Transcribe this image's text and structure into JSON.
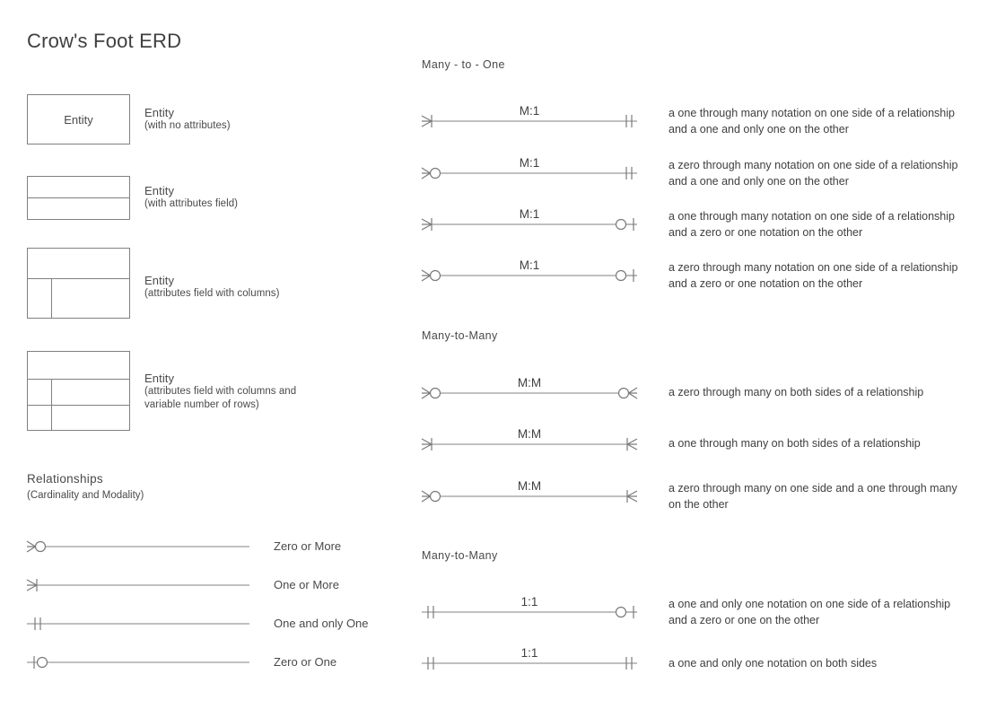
{
  "page": {
    "title": "Crow's Foot ERD",
    "background": "#ffffff",
    "line_color": "#808080",
    "text_color": "#4a4a4a"
  },
  "entities": {
    "section_items": [
      {
        "shape": "single-box",
        "inner_text": "Entity",
        "caption_title": "Entity",
        "caption_sub": "(with no attributes)"
      },
      {
        "shape": "header-plus-one-row",
        "inner_text": "",
        "caption_title": "Entity",
        "caption_sub": "(with attributes field)"
      },
      {
        "shape": "header-plus-columns",
        "inner_text": "",
        "caption_title": "Entity",
        "caption_sub": "(attributes field with columns)"
      },
      {
        "shape": "header-plus-columns-multirow",
        "inner_text": "",
        "caption_title": "Entity",
        "caption_sub": "(attributes field with columns and variable number of rows)"
      }
    ]
  },
  "relationships_section": {
    "heading": "Relationships",
    "subheading": "(Cardinality and Modality)",
    "legend": [
      {
        "symbol": "zero-or-more",
        "label": "Zero or More"
      },
      {
        "symbol": "one-or-more",
        "label": "One or More"
      },
      {
        "symbol": "one-and-only-one",
        "label": "One and only One"
      },
      {
        "symbol": "zero-or-one",
        "label": "Zero or One"
      }
    ]
  },
  "groups": [
    {
      "heading": "Many - to - One",
      "rows": [
        {
          "ratio": "M:1",
          "left_symbol": "one-or-more",
          "right_symbol": "one-and-only-one",
          "description": "a one through many notation on one side of a relationship and a one and only one on the other"
        },
        {
          "ratio": "M:1",
          "left_symbol": "zero-or-more",
          "right_symbol": "one-and-only-one",
          "description": "a zero through many notation on one side of a relationship and a one and only one on the other"
        },
        {
          "ratio": "M:1",
          "left_symbol": "one-or-more",
          "right_symbol": "zero-or-one",
          "description": "a one through many notation on one side of a relationship and a zero or one notation on the other"
        },
        {
          "ratio": "M:1",
          "left_symbol": "zero-or-more",
          "right_symbol": "zero-or-one",
          "description": "a zero through many notation on one side of a relationship and a zero or one notation on the other"
        }
      ]
    },
    {
      "heading": "Many-to-Many",
      "rows": [
        {
          "ratio": "M:M",
          "left_symbol": "zero-or-more",
          "right_symbol": "zero-or-more",
          "description": "a zero through many on both sides of a relationship"
        },
        {
          "ratio": "M:M",
          "left_symbol": "one-or-more",
          "right_symbol": "one-or-more",
          "description": "a one through many on both sides of a relationship"
        },
        {
          "ratio": "M:M",
          "left_symbol": "zero-or-more",
          "right_symbol": "one-or-more",
          "description": "a zero through many on one side and a one through many on the other"
        }
      ]
    },
    {
      "heading": "Many-to-Many",
      "rows": [
        {
          "ratio": "1:1",
          "left_symbol": "one-and-only-one",
          "right_symbol": "zero-or-one",
          "description": "a one and only one notation on one side of a relationship and a zero or one on the other"
        },
        {
          "ratio": "1:1",
          "left_symbol": "one-and-only-one",
          "right_symbol": "one-and-only-one",
          "description": "a one and only one notation on both sides"
        }
      ]
    }
  ]
}
